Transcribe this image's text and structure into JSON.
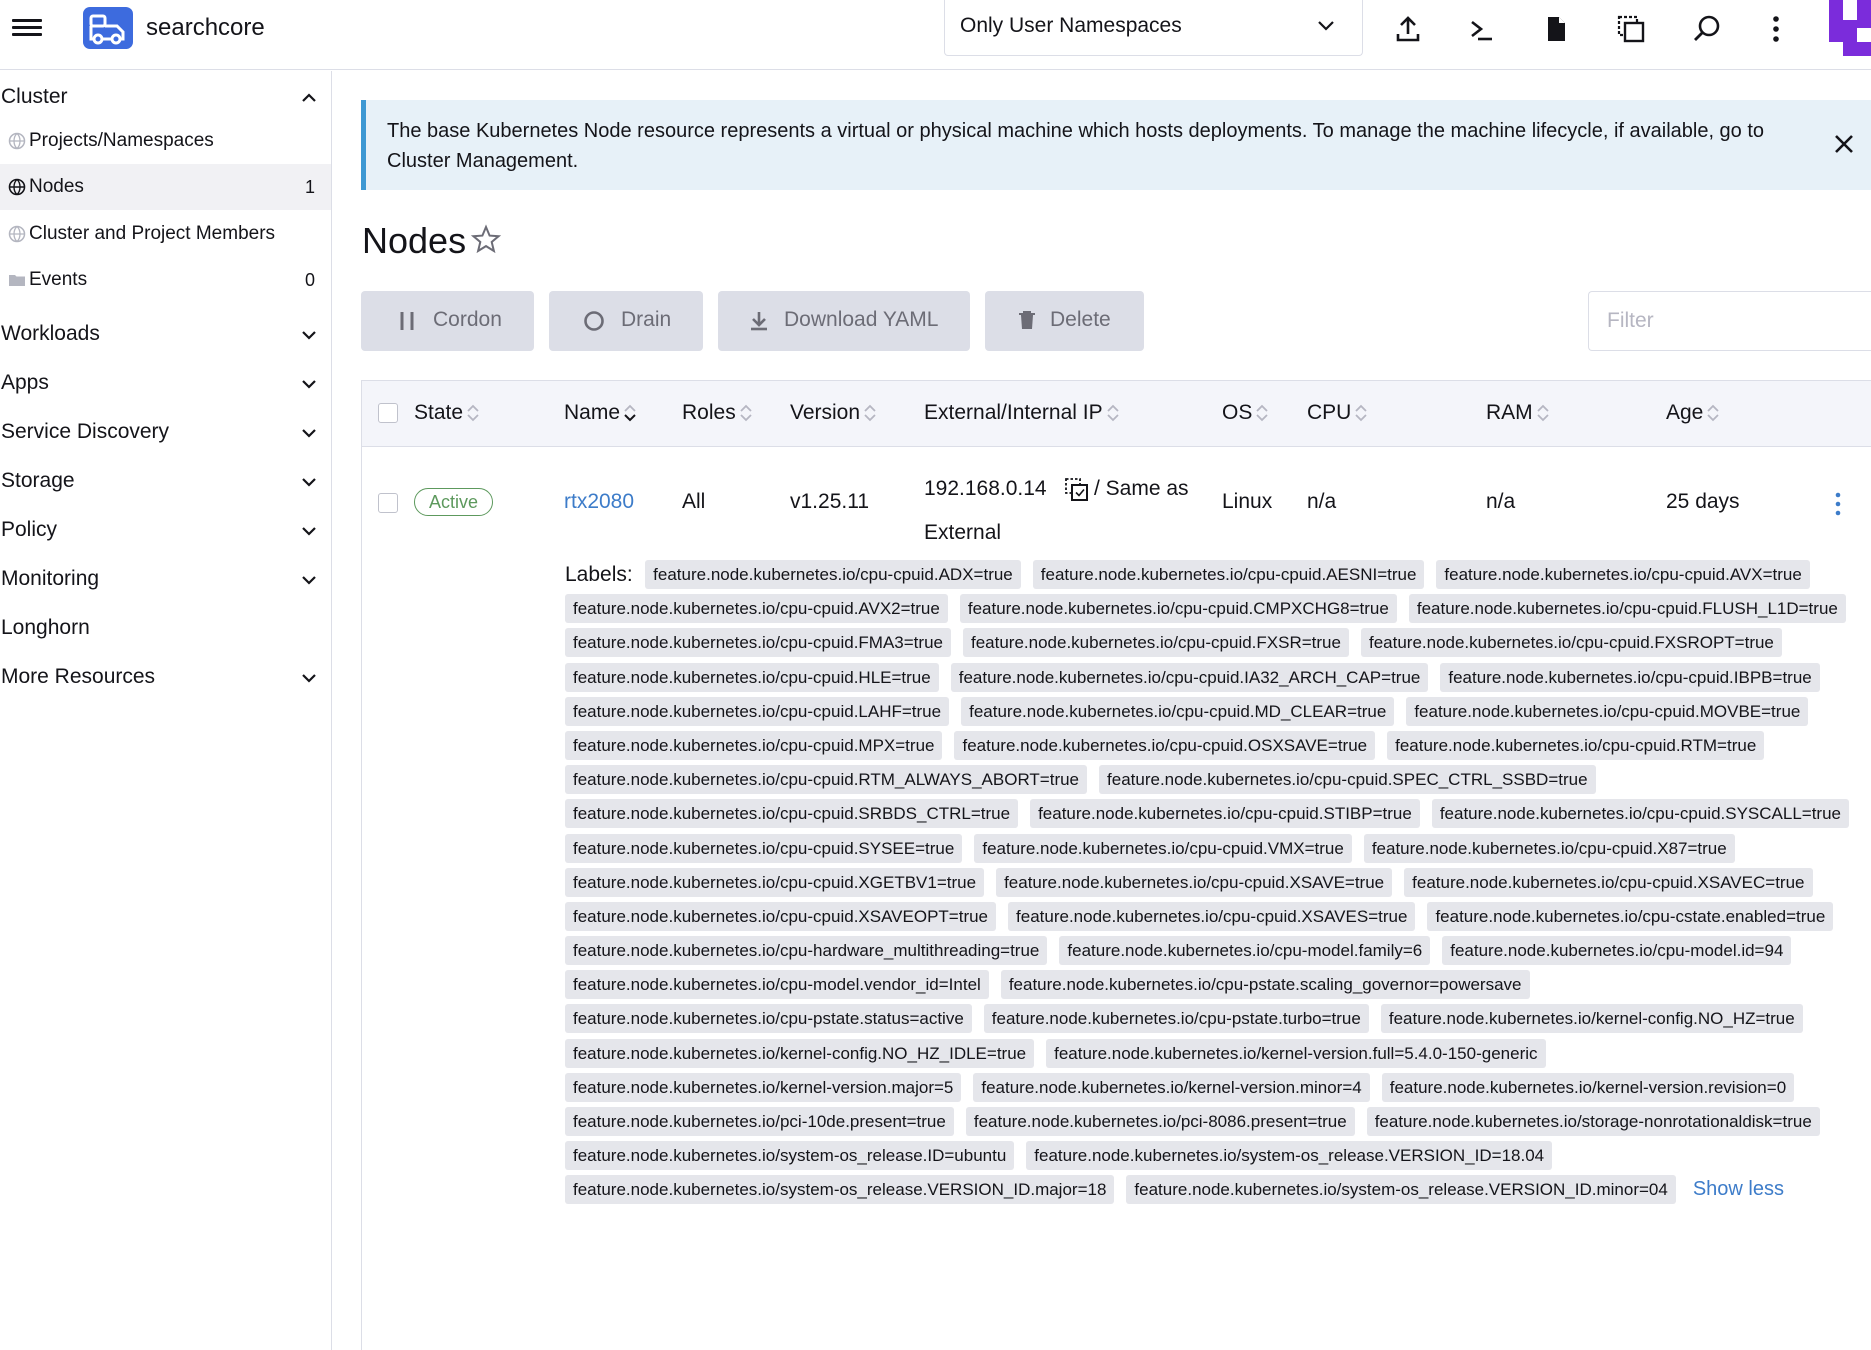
{
  "header": {
    "cluster_name": "searchcore",
    "namespace_filter": "Only User Namespaces",
    "icons": [
      "import-yaml-icon",
      "kubectl-shell-icon",
      "kubeconfig-file-icon",
      "copy-kubeconfig-icon",
      "search-icon",
      "more-options-icon"
    ]
  },
  "sidebar": {
    "cluster": "Cluster",
    "items": [
      {
        "label": "Projects/Namespaces",
        "count": ""
      },
      {
        "label": "Nodes",
        "count": "1"
      },
      {
        "label": "Cluster and Project Members",
        "count": ""
      },
      {
        "label": "Events",
        "count": "0"
      }
    ],
    "groups": [
      "Workloads",
      "Apps",
      "Service Discovery",
      "Storage",
      "Policy",
      "Monitoring",
      "Longhorn",
      "More Resources"
    ]
  },
  "banner": {
    "text": "The base Kubernetes Node resource represents a virtual or physical machine which hosts deployments. To manage the machine lifecycle, if available, go to Cluster Management."
  },
  "page": {
    "title": "Nodes"
  },
  "actions": {
    "cordon": "Cordon",
    "drain": "Drain",
    "download_yaml": "Download YAML",
    "delete": "Delete",
    "filter_placeholder": "Filter"
  },
  "table": {
    "columns": [
      "State",
      "Name",
      "Roles",
      "Version",
      "External/Internal IP",
      "OS",
      "CPU",
      "RAM",
      "Age"
    ],
    "row": {
      "state": "Active",
      "name": "rtx2080",
      "roles": "All",
      "version": "v1.25.11",
      "external_ip": "192.168.0.14",
      "internal_ip_line1": "/ Same as",
      "internal_ip_line2": "External",
      "os": "Linux",
      "cpu": "n/a",
      "ram": "n/a",
      "age": "25 days"
    },
    "labels_title": "Labels:",
    "show_less": "Show less",
    "labels": [
      "feature.node.kubernetes.io/cpu-cpuid.ADX=true",
      "feature.node.kubernetes.io/cpu-cpuid.AESNI=true",
      "feature.node.kubernetes.io/cpu-cpuid.AVX=true",
      "feature.node.kubernetes.io/cpu-cpuid.AVX2=true",
      "feature.node.kubernetes.io/cpu-cpuid.CMPXCHG8=true",
      "feature.node.kubernetes.io/cpu-cpuid.FLUSH_L1D=true",
      "feature.node.kubernetes.io/cpu-cpuid.FMA3=true",
      "feature.node.kubernetes.io/cpu-cpuid.FXSR=true",
      "feature.node.kubernetes.io/cpu-cpuid.FXSROPT=true",
      "feature.node.kubernetes.io/cpu-cpuid.HLE=true",
      "feature.node.kubernetes.io/cpu-cpuid.IA32_ARCH_CAP=true",
      "feature.node.kubernetes.io/cpu-cpuid.IBPB=true",
      "feature.node.kubernetes.io/cpu-cpuid.LAHF=true",
      "feature.node.kubernetes.io/cpu-cpuid.MD_CLEAR=true",
      "feature.node.kubernetes.io/cpu-cpuid.MOVBE=true",
      "feature.node.kubernetes.io/cpu-cpuid.MPX=true",
      "feature.node.kubernetes.io/cpu-cpuid.OSXSAVE=true",
      "feature.node.kubernetes.io/cpu-cpuid.RTM=true",
      "feature.node.kubernetes.io/cpu-cpuid.RTM_ALWAYS_ABORT=true",
      "feature.node.kubernetes.io/cpu-cpuid.SPEC_CTRL_SSBD=true",
      "feature.node.kubernetes.io/cpu-cpuid.SRBDS_CTRL=true",
      "feature.node.kubernetes.io/cpu-cpuid.STIBP=true",
      "feature.node.kubernetes.io/cpu-cpuid.SYSCALL=true",
      "feature.node.kubernetes.io/cpu-cpuid.SYSEE=true",
      "feature.node.kubernetes.io/cpu-cpuid.VMX=true",
      "feature.node.kubernetes.io/cpu-cpuid.X87=true",
      "feature.node.kubernetes.io/cpu-cpuid.XGETBV1=true",
      "feature.node.kubernetes.io/cpu-cpuid.XSAVE=true",
      "feature.node.kubernetes.io/cpu-cpuid.XSAVEC=true",
      "feature.node.kubernetes.io/cpu-cpuid.XSAVEOPT=true",
      "feature.node.kubernetes.io/cpu-cpuid.XSAVES=true",
      "feature.node.kubernetes.io/cpu-cstate.enabled=true",
      "feature.node.kubernetes.io/cpu-hardware_multithreading=true",
      "feature.node.kubernetes.io/cpu-model.family=6",
      "feature.node.kubernetes.io/cpu-model.id=94",
      "feature.node.kubernetes.io/cpu-model.vendor_id=Intel",
      "feature.node.kubernetes.io/cpu-pstate.scaling_governor=powersave",
      "feature.node.kubernetes.io/cpu-pstate.status=active",
      "feature.node.kubernetes.io/cpu-pstate.turbo=true",
      "feature.node.kubernetes.io/kernel-config.NO_HZ=true",
      "feature.node.kubernetes.io/kernel-config.NO_HZ_IDLE=true",
      "feature.node.kubernetes.io/kernel-version.full=5.4.0-150-generic",
      "feature.node.kubernetes.io/kernel-version.major=5",
      "feature.node.kubernetes.io/kernel-version.minor=4",
      "feature.node.kubernetes.io/kernel-version.revision=0",
      "feature.node.kubernetes.io/pci-10de.present=true",
      "feature.node.kubernetes.io/pci-8086.present=true",
      "feature.node.kubernetes.io/storage-nonrotationaldisk=true",
      "feature.node.kubernetes.io/system-os_release.ID=ubuntu",
      "feature.node.kubernetes.io/system-os_release.VERSION_ID=18.04",
      "feature.node.kubernetes.io/system-os_release.VERSION_ID.major=18",
      "feature.node.kubernetes.io/system-os_release.VERSION_ID.minor=04"
    ]
  },
  "colors": {
    "brand": "#3d6bde",
    "link": "#3d7cc9",
    "active_badge": "#5d995d",
    "banner_bg": "#e7f1f8",
    "banner_border": "#3d98d3",
    "button_bg": "#dcdee7",
    "chip_bg": "#e5e6eb"
  }
}
